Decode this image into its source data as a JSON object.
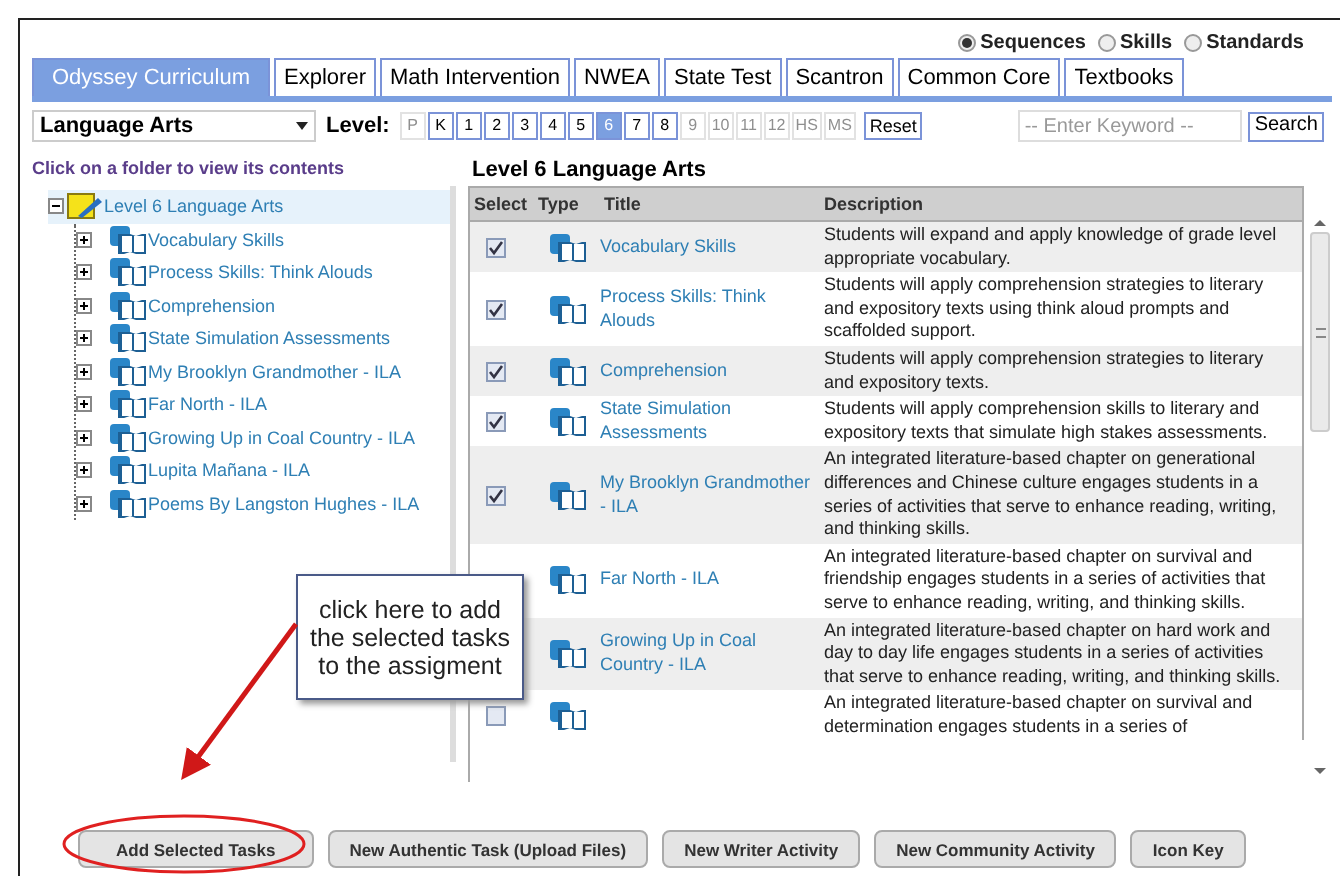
{
  "view_modes": [
    {
      "label": "Sequences",
      "selected": true
    },
    {
      "label": "Skills",
      "selected": false
    },
    {
      "label": "Standards",
      "selected": false
    }
  ],
  "tabs": [
    {
      "label": "Odyssey Curriculum",
      "selected": true
    },
    {
      "label": "Explorer",
      "selected": false
    },
    {
      "label": "Math Intervention",
      "selected": false
    },
    {
      "label": "NWEA",
      "selected": false
    },
    {
      "label": "State Test",
      "selected": false
    },
    {
      "label": "Scantron",
      "selected": false
    },
    {
      "label": "Common Core",
      "selected": false
    },
    {
      "label": "Textbooks",
      "selected": false
    }
  ],
  "subject": {
    "value": "Language Arts"
  },
  "level_label": "Level:",
  "levels": [
    {
      "label": "P",
      "disabled": true,
      "selected": false
    },
    {
      "label": "K",
      "disabled": false,
      "selected": false
    },
    {
      "label": "1",
      "disabled": false,
      "selected": false
    },
    {
      "label": "2",
      "disabled": false,
      "selected": false
    },
    {
      "label": "3",
      "disabled": false,
      "selected": false
    },
    {
      "label": "4",
      "disabled": false,
      "selected": false
    },
    {
      "label": "5",
      "disabled": false,
      "selected": false
    },
    {
      "label": "6",
      "disabled": false,
      "selected": true
    },
    {
      "label": "7",
      "disabled": false,
      "selected": false
    },
    {
      "label": "8",
      "disabled": false,
      "selected": false
    },
    {
      "label": "9",
      "disabled": true,
      "selected": false
    },
    {
      "label": "10",
      "disabled": true,
      "selected": false
    },
    {
      "label": "11",
      "disabled": true,
      "selected": false
    },
    {
      "label": "12",
      "disabled": true,
      "selected": false
    },
    {
      "label": "HS",
      "disabled": true,
      "selected": false
    },
    {
      "label": "MS",
      "disabled": true,
      "selected": false
    }
  ],
  "reset_button": "Reset",
  "keyword": {
    "placeholder": "-- Enter Keyword --"
  },
  "search_button": "Search",
  "tree_hint": "Click on a folder to view its contents",
  "tree": [
    {
      "label": "Level 6 Language Arts",
      "expanded": true,
      "selected": true,
      "children": [
        {
          "label": "Vocabulary Skills",
          "expanded": false,
          "selected": false
        },
        {
          "label": "Process Skills: Think Alouds",
          "expanded": false,
          "selected": false
        },
        {
          "label": "Comprehension",
          "expanded": false,
          "selected": false
        },
        {
          "label": "State Simulation Assessments",
          "expanded": false,
          "selected": false
        },
        {
          "label": "My Brooklyn Grandmother - ILA",
          "expanded": false,
          "selected": false
        },
        {
          "label": "Far North - ILA",
          "expanded": false,
          "selected": false
        },
        {
          "label": "Growing Up in Coal Country - ILA",
          "expanded": false,
          "selected": false
        },
        {
          "label": "Lupita Mañana - ILA",
          "expanded": false,
          "selected": false
        },
        {
          "label": "Poems By Langston Hughes - ILA",
          "expanded": false,
          "selected": false
        }
      ]
    }
  ],
  "table": {
    "heading": "Level 6 Language Arts",
    "columns": [
      "Select",
      "Type",
      "Title",
      "Description"
    ],
    "rows": [
      {
        "checked": true,
        "title": "Vocabulary Skills",
        "description": "Students will expand and apply knowledge of grade level appropriate vocabulary."
      },
      {
        "checked": true,
        "title": "Process Skills: Think Alouds",
        "description": "Students will apply comprehension strategies to literary and expository texts using think aloud prompts and scaffolded support."
      },
      {
        "checked": true,
        "title": "Comprehension",
        "description": "Students will apply comprehension strategies to literary and expository texts."
      },
      {
        "checked": true,
        "title": "State Simulation Assessments",
        "description": "Students will apply comprehension skills to literary and expository texts that simulate high stakes assessments."
      },
      {
        "checked": true,
        "title": "My Brooklyn Grandmother - ILA",
        "description": "An integrated literature-based chapter on generational differences and Chinese culture engages students in a series of activities that serve to enhance reading, writing, and thinking skills."
      },
      {
        "title": "Far North - ILA",
        "description": "An integrated literature-based chapter on survival and friendship engages students in a series of activities that serve to enhance reading, writing, and thinking skills."
      },
      {
        "title": "Growing Up in Coal Country - ILA",
        "description": "An integrated literature-based chapter on hard work and day to day life engages students in a series of activities that serve to enhance reading, writing, and thinking skills."
      },
      {
        "checked": false,
        "description": "An integrated literature-based chapter on survival and determination engages students in a series of"
      }
    ]
  },
  "buttons": [
    "Add Selected Tasks",
    "New Authentic Task (Upload Files)",
    "New Writer Activity",
    "New Community Activity",
    "Icon Key"
  ],
  "callout": {
    "text": "click here to add the selected tasks to the assigment"
  }
}
